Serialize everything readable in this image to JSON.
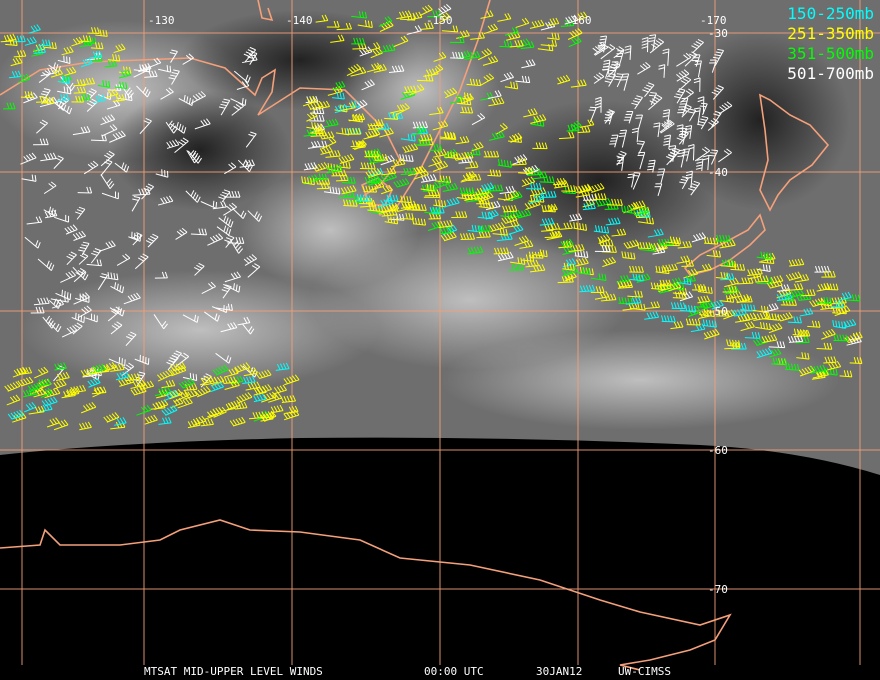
{
  "longitude_labels": [
    "-130",
    "-140",
    "-150",
    "-160",
    "-170"
  ],
  "latitude_labels": [
    "-30",
    "-40",
    "-50",
    "-60",
    "-70"
  ],
  "legend": [
    {
      "label": "150-250mb",
      "color": "#00ffff"
    },
    {
      "label": "251-350mb",
      "color": "#ffff00"
    },
    {
      "label": "351-500mb",
      "color": "#00ff00"
    },
    {
      "label": "501-700mb",
      "color": "#ffffff"
    }
  ],
  "footer": {
    "product": "MTSAT MID-UPPER LEVEL WINDS",
    "time": "00:00 UTC",
    "date": "30JAN12",
    "credit": "UW-CIMSS"
  },
  "colors": {
    "grid": "#f4a07a",
    "coast": "#f4a07a",
    "space": "#000000",
    "cloud": "#8a8a8a"
  }
}
